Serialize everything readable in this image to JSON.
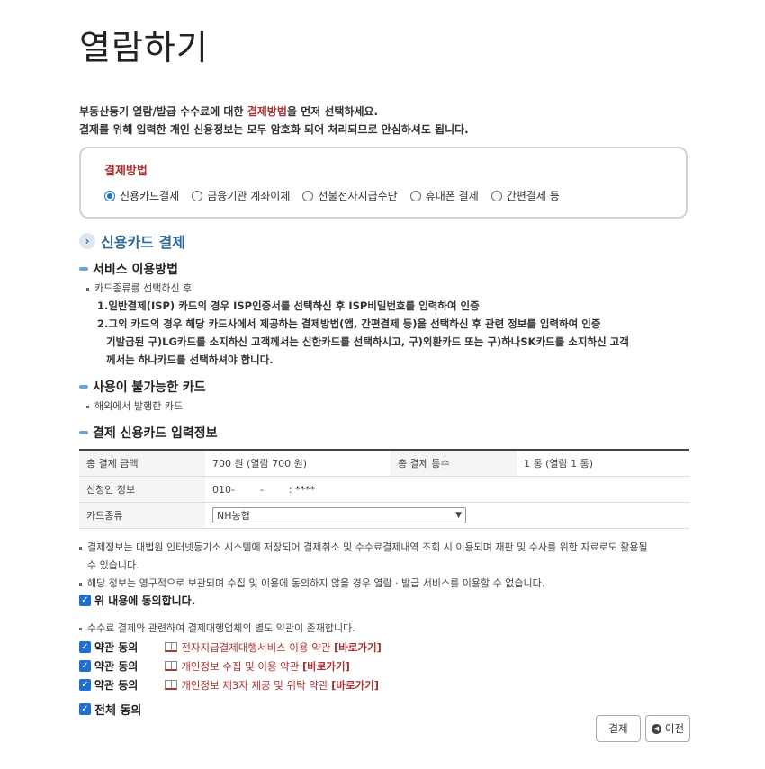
{
  "page_title": "열람하기",
  "intro": {
    "line1_a": "부동산등기 열람/발급 수수료에 대한 ",
    "line1_hl": "결제방법",
    "line1_b": "을 먼저 선택하세요.",
    "line2": "결제를 위해 입력한 개인 신용정보는 모두 암호화 되어 처리되므로 안심하셔도 됩니다."
  },
  "payment_method": {
    "label": "결제방법",
    "options": [
      "신용카드결제",
      "금융기관 계좌이체",
      "선불전자지급수단",
      "휴대폰 결제",
      "간편결제 등"
    ],
    "selected_index": 0
  },
  "section_title": "신용카드 결제",
  "service": {
    "title": "서비스 이용방법",
    "bullet": "카드종류를 선택하신 후",
    "step1": "1.일반결제(ISP) 카드의 경우 ISP인증서를 선택하신 후 ISP비밀번호를 입력하여 인증",
    "step2_l1": "2.그외 카드의 경우 해당 카드사에서 제공하는 결제방법(앱, 간편결제 등)을 선택하신 후 관련 정보를 입력하여 인증",
    "step2_l2": "기발급된 구)LG카드를 소지하신 고객께서는 신한카드를 선택하시고, 구)외환카드 또는 구)하나SK카드를 소지하신 고객",
    "step2_l3": "께서는 하나카드를 선택하셔야 합니다."
  },
  "unavailable": {
    "title": "사용이 불가능한 카드",
    "bullet": "해외에서 발행한 카드"
  },
  "input_info": {
    "title": "결제 신용카드 입력정보",
    "total_amount_label": "총 결제 금액",
    "total_amount_value": "700 원 (열람 700 원)",
    "total_count_label": "총 결제 통수",
    "total_count_value": "1 통 (열람 1 통)",
    "applicant_label": "신청인 정보",
    "applicant_value": "010-        -        : ****",
    "card_type_label": "카드종류",
    "card_type_value": "NH농협"
  },
  "notes": {
    "note1_l1": "결제정보는 대법원 인터넷등기소 시스템에 저장되어 결제취소 및 수수료결제내역 조회 시 이용되며 재판 및 수사를 위한 자료로도 활용될",
    "note1_l2": "수 있습니다.",
    "note2": "해당 정보는 영구적으로 보관되며 수집 및 이용에 동의하지 않을 경우 열람 · 발급 서비스를 이용할 수 없습니다.",
    "agree_above": "위 내용에 동의합니다.",
    "note3": "수수료 결제와 관련하여 결제대행업체의 별도 약관이 존재합니다."
  },
  "terms": [
    {
      "check_label": "약관 동의",
      "text": "전자지급결제대행서비스 이용 약관 ",
      "link": "[바로가기]"
    },
    {
      "check_label": "약관 동의",
      "text": "개인정보 수집 및 이용 약관 ",
      "link": "[바로가기]"
    },
    {
      "check_label": "약관 동의",
      "text": "개인정보 제3자 제공 및 위탁 약관 ",
      "link": "[바로가기]"
    }
  ],
  "all_agree": "전체 동의",
  "buttons": {
    "pay": "결제",
    "prev": "이전"
  },
  "colors": {
    "accent_red": "#aa3333",
    "blue": "#1f6fd1",
    "section_blue": "#2f6a9a"
  }
}
